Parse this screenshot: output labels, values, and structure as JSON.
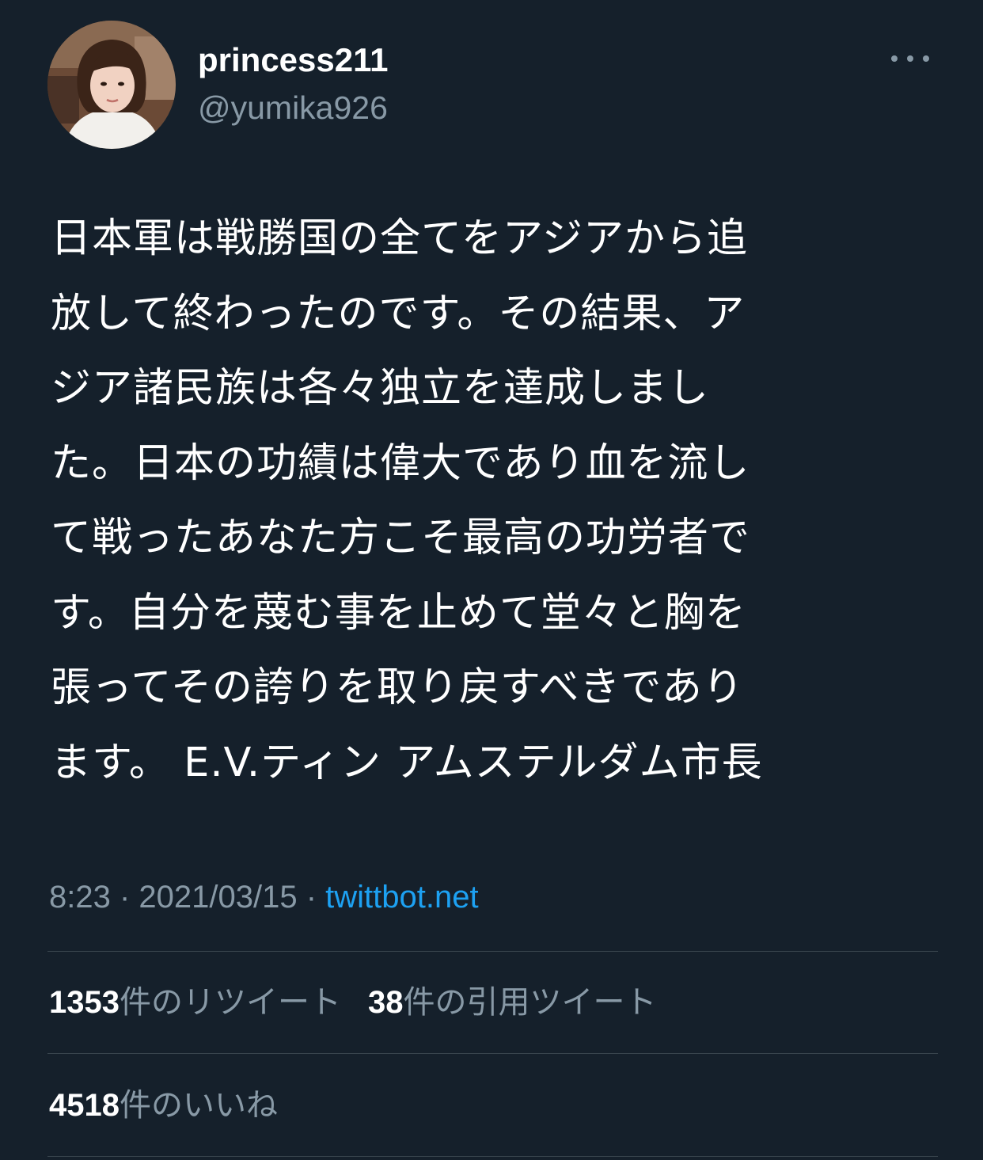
{
  "user": {
    "display_name": "princess211",
    "handle": "@yumika926"
  },
  "tweet": {
    "text": "日本軍は戦勝国の全てをアジアから追\n放して終わったのです。その結果、ア\nジア諸民族は各々独立を達成しまし\nた。日本の功績は偉大であり血を流し\nて戦ったあなた方こそ最高の功労者で\nす。自分を蔑む事を止めて堂々と胸を\n張ってその誇りを取り戻すべきであり\nます。 E.V.ティン アムステルダム市長"
  },
  "meta": {
    "time": "8:23",
    "sep1": " · ",
    "date": "2021/03/15",
    "sep2": " · ",
    "source": "twittbot.net"
  },
  "stats": {
    "retweets": {
      "count": "1353",
      "label": "件のリツイート"
    },
    "quotes": {
      "count": "38",
      "label": "件の引用ツイート"
    },
    "likes": {
      "count": "4518",
      "label": "件のいいね"
    }
  },
  "icons": {
    "more": "more-dots-icon",
    "avatar": "profile-photo"
  },
  "colors": {
    "background": "#15202b",
    "text": "#ffffff",
    "secondary": "#8899a6",
    "link": "#1da1f2",
    "divider": "#38444d"
  }
}
